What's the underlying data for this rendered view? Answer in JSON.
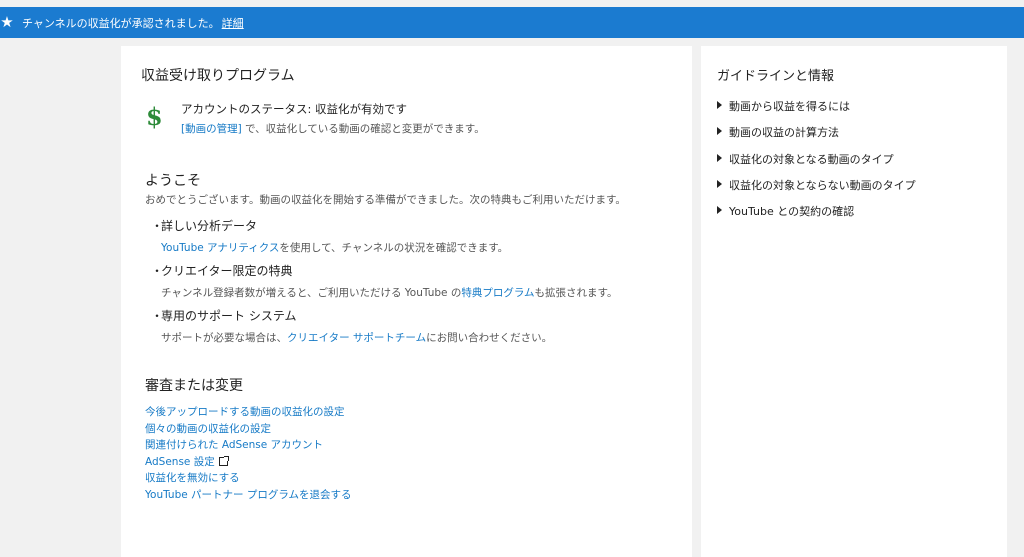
{
  "banner": {
    "icon": "star-icon",
    "message": "チャンネルの収益化が承認されました。",
    "link": "詳細"
  },
  "main": {
    "title": "収益受け取りプログラム",
    "status": {
      "icon": "dollar-icon",
      "label": "アカウントのステータス: 収益化が有効です",
      "manage_link": "[動画の管理]",
      "manage_suffix": " で、収益化している動画の確認と変更ができます。"
    },
    "welcome": {
      "title": "ようこそ",
      "description": "おめでとうございます。動画の収益化を開始する準備ができました。次の特典もご利用いただけます。"
    },
    "benefits": [
      {
        "title": "詳しい分析データ",
        "link": "YouTube アナリティクス",
        "after": "を使用して、チャンネルの状況を確認できます。"
      },
      {
        "title": "クリエイター限定の特典",
        "before": "チャンネル登録者数が増えると、ご利用いただける YouTube の",
        "link": "特典プログラム",
        "after": "も拡張されます。"
      },
      {
        "title": "専用のサポート システム",
        "before": "サポートが必要な場合は、",
        "link": "クリエイター サポートチーム",
        "after": "にお問い合わせください。"
      }
    ],
    "review": {
      "title": "審査または変更",
      "links": [
        "今後アップロードする動画の収益化の設定",
        "個々の動画の収益化の設定",
        "関連付けられた AdSense アカウント",
        "AdSense 設定",
        "収益化を無効にする",
        "YouTube パートナー プログラムを退会する"
      ]
    }
  },
  "sidebar": {
    "title": "ガイドラインと情報",
    "items": [
      "動画から収益を得るには",
      "動画の収益の計算方法",
      "収益化の対象となる動画のタイプ",
      "収益化の対象とならない動画のタイプ",
      "YouTube との契約の確認"
    ]
  }
}
